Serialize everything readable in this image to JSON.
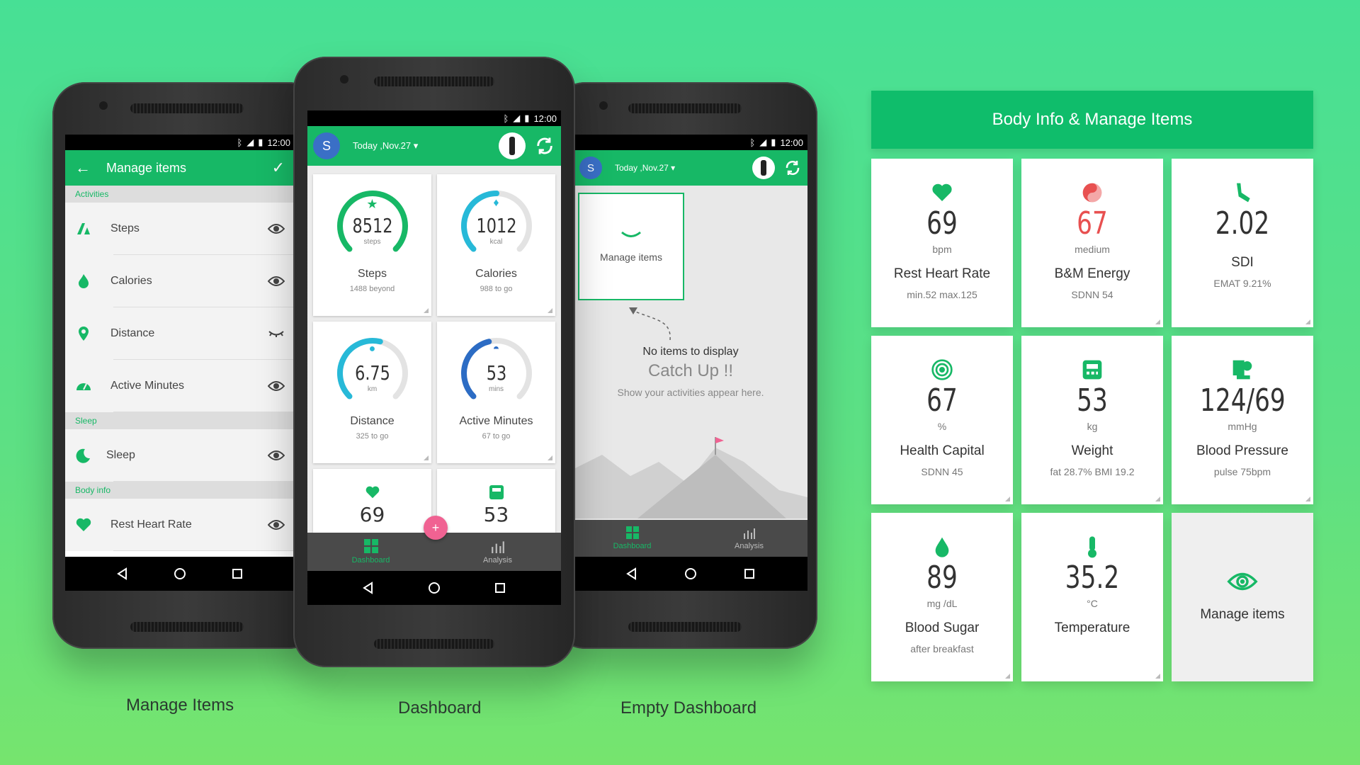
{
  "status": {
    "time": "12:00"
  },
  "manage": {
    "title": "Manage items",
    "sections": [
      {
        "label": "Activities",
        "items": [
          "Steps",
          "Calories",
          "Distance",
          "Active Minutes"
        ]
      },
      {
        "label": "Sleep",
        "items": [
          "Sleep"
        ]
      },
      {
        "label": "Body info",
        "items": [
          "Rest Heart Rate"
        ]
      }
    ]
  },
  "dashboard": {
    "avatar": "S",
    "date": "Today ,Nov.27",
    "cards": [
      {
        "value": "8512",
        "unit": "steps",
        "name": "Steps",
        "sub": "1488  beyond",
        "color": "#17b866",
        "fraction": 1.0
      },
      {
        "value": "1012",
        "unit": "kcal",
        "name": "Calories",
        "sub": "988 to go",
        "color": "#27b9d8",
        "fraction": 0.5
      },
      {
        "value": "6.75",
        "unit": "km",
        "name": "Distance",
        "sub": "325 to go",
        "color": "#27b9d8",
        "fraction": 0.55
      },
      {
        "value": "53",
        "unit": "mins",
        "name": "Active Minutes",
        "sub": "67 to go",
        "color": "#2c6cc4",
        "fraction": 0.45
      }
    ],
    "partial_values": [
      "69",
      "53"
    ],
    "tabs": {
      "dashboard": "Dashboard",
      "analysis": "Analysis"
    }
  },
  "empty": {
    "date": "Today ,Nov.27",
    "manage_label": "Manage items",
    "no_items": "No items to display",
    "catch_up": "Catch Up !!",
    "hint": "Show your activities appear here."
  },
  "captions": {
    "manage": "Manage Items",
    "dashboard": "Dashboard",
    "empty": "Empty Dashboard"
  },
  "panel": {
    "title": "Body Info & Manage Items",
    "tiles": [
      {
        "icon": "heart-icon",
        "value": "69",
        "unit": "bpm",
        "name": "Rest Heart Rate",
        "sub": "min.52 max.125",
        "color": "#17b866"
      },
      {
        "icon": "energy-icon",
        "value": "67",
        "unit": "medium",
        "name": "B&M Energy",
        "sub": "SDNN 54",
        "color": "#e85050"
      },
      {
        "icon": "foot-icon",
        "value": "2.02",
        "unit": "",
        "name": "SDI",
        "sub": "EMAT 9.21%",
        "color": "#17b866"
      },
      {
        "icon": "health-icon",
        "value": "67",
        "unit": "%",
        "name": "Health Capital",
        "sub": "SDNN 45",
        "color": "#17b866"
      },
      {
        "icon": "scale-icon",
        "value": "53",
        "unit": "kg",
        "name": "Weight",
        "sub": "fat 28.7%   BMI 19.2",
        "color": "#17b866"
      },
      {
        "icon": "bp-icon",
        "value": "124/69",
        "unit": "mmHg",
        "name": "Blood Pressure",
        "sub": "pulse 75bpm",
        "color": "#17b866"
      },
      {
        "icon": "drop-icon",
        "value": "89",
        "unit": "mg /dL",
        "name": "Blood Sugar",
        "sub": "after breakfast",
        "color": "#17b866"
      },
      {
        "icon": "thermometer-icon",
        "value": "35.2",
        "unit": "°C",
        "name": "Temperature",
        "sub": "",
        "color": "#17b866"
      }
    ],
    "manage_label": "Manage items"
  }
}
